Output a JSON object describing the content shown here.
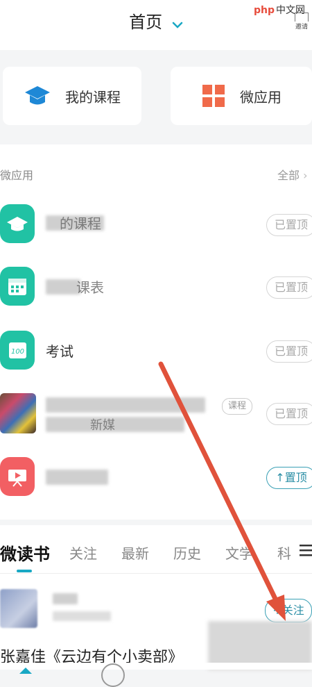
{
  "header": {
    "title": "首页",
    "invite_label": "邀请",
    "watermark_logo": "php",
    "watermark_text": "中文网"
  },
  "quick_cards": [
    {
      "label": "我的课程",
      "icon": "graduation-cap-icon",
      "color": "#1e88d6"
    },
    {
      "label": "微应用",
      "icon": "grid-icon",
      "color": "#f06a4a"
    }
  ],
  "micro_apps": {
    "title": "微应用",
    "all_label": "全部",
    "rows": [
      {
        "label": "的课程",
        "icon": "graduation-cap-icon",
        "color": "#21c2a4",
        "pin": "已置顶",
        "pinned": true
      },
      {
        "label": "课表",
        "icon": "calendar-icon",
        "color": "#21c2a4",
        "pin": "已置顶",
        "pinned": true
      },
      {
        "label": "考试",
        "icon": "exam-100-icon",
        "color": "#21c2a4",
        "pin": "已置顶",
        "pinned": true
      },
      {
        "label": "新媒",
        "icon": "thumbnail-image",
        "color": "#555555",
        "tag": "课程",
        "pin": "已置顶",
        "pinned": true
      },
      {
        "label": "",
        "icon": "presentation-icon",
        "color": "#f25f63",
        "pin": "↑置顶",
        "pinned": false
      }
    ]
  },
  "reading": {
    "title": "微读书",
    "tabs": [
      "关注",
      "最新",
      "历史",
      "文学",
      "科"
    ],
    "follow_label": "+关注",
    "headline": "张嘉佳《云边有个小卖部》"
  },
  "colors": {
    "accent": "#19a8c4",
    "arrow": "#e0523b"
  }
}
